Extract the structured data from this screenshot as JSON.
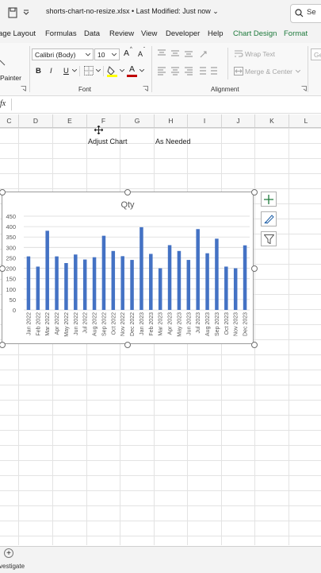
{
  "titlebar": {
    "file_title": "shorts-chart-no-resize.xlsx • Last Modified: Just now ⌄",
    "search_partial": "Se"
  },
  "tabs": [
    {
      "label": "age Layout"
    },
    {
      "label": "Formulas"
    },
    {
      "label": "Data"
    },
    {
      "label": "Review"
    },
    {
      "label": "View"
    },
    {
      "label": "Developer"
    },
    {
      "label": "Help"
    },
    {
      "label": "Chart Design"
    },
    {
      "label": "Format"
    }
  ],
  "ribbon": {
    "painter_label": "Painter",
    "font_name": "Calibri (Body)",
    "font_size": "10",
    "grow_font": "A",
    "shrink_font": "A",
    "bold": "B",
    "italic": "I",
    "underline": "U",
    "font_color_letter": "A",
    "font_group_label": "Font",
    "wrap_text": "Wrap Text",
    "merge_center": "Merge & Center",
    "alignment_group_label": "Alignment",
    "general_partial": "Ge"
  },
  "formula_bar": {
    "fx_label": "fx",
    "value": ""
  },
  "columns": [
    "C",
    "D",
    "E",
    "F",
    "G",
    "H",
    "I",
    "J",
    "K",
    "L"
  ],
  "cells": {
    "f_label": "Adjust Chart",
    "h_label": "As Needed"
  },
  "chart_data": {
    "type": "bar",
    "title": "Qty",
    "xlabel": "",
    "ylabel": "",
    "ylim": [
      0,
      450
    ],
    "yticks": [
      0,
      50,
      100,
      150,
      200,
      250,
      300,
      350,
      400,
      450
    ],
    "grid": true,
    "legend": "none",
    "bar_color": "#4472c4",
    "categories": [
      "Jan 2022",
      "Feb 2022",
      "Mar 2022",
      "Apr 2022",
      "May 2022",
      "Jun 2022",
      "Jul 2022",
      "Aug 2022",
      "Sep 2022",
      "Oct 2022",
      "Nov 2022",
      "Dec 2022",
      "Jan 2023",
      "Feb 2023",
      "Mar 2023",
      "Apr 2023",
      "May 2023",
      "Jun 2023",
      "Jul 2023",
      "Aug 2023",
      "Sep 2023",
      "Oct 2023",
      "Nov 2023",
      "Dec 2023"
    ],
    "values": [
      257,
      208,
      380,
      257,
      225,
      266,
      242,
      253,
      356,
      283,
      258,
      240,
      397,
      269,
      200,
      311,
      283,
      240,
      388,
      272,
      342,
      208,
      200,
      310
    ]
  },
  "sheetbar": {
    "add_sheet": "+",
    "status_partial": "vestigate"
  },
  "colors": {
    "accent_green": "#1e7a3c",
    "bar_blue": "#4472c4",
    "font_color_red": "#c00000",
    "highlight_yellow": "#ffff00"
  }
}
